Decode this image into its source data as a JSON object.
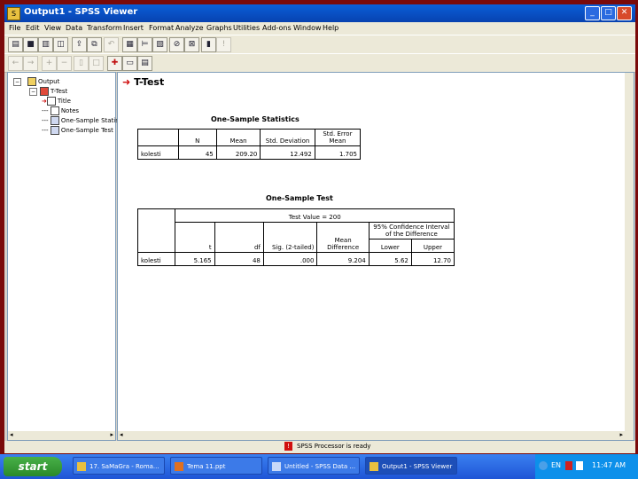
{
  "window": {
    "title": "Output1 - SPSS Viewer"
  },
  "menu": [
    "File",
    "Edit",
    "View",
    "Data",
    "Transform",
    "Insert",
    "Format",
    "Analyze",
    "Graphs",
    "Utilities",
    "Add-ons",
    "Window",
    "Help"
  ],
  "tree": {
    "items": [
      {
        "label": "Output"
      },
      {
        "label": "T-Test"
      },
      {
        "label": "Title"
      },
      {
        "label": "Notes"
      },
      {
        "label": "One-Sample Statis"
      },
      {
        "label": "One-Sample Test"
      }
    ]
  },
  "content": {
    "heading": "T-Test",
    "stats": {
      "title": "One-Sample Statistics",
      "headers": [
        "N",
        "Mean",
        "Std. Deviation",
        "Std. Error Mean"
      ],
      "row": {
        "label": "kolesti",
        "values": [
          "45",
          "209.20",
          "12.492",
          "1.705"
        ]
      }
    },
    "test": {
      "title": "One-Sample Test",
      "test_value": "Test Value = 200",
      "ci_header": "95% Confidence Interval of the Difference",
      "headers": [
        "t",
        "df",
        "Sig. (2-tailed)",
        "Mean Difference",
        "Lower",
        "Upper"
      ],
      "row": {
        "label": "kolesti",
        "values": [
          "5.165",
          "48",
          ".000",
          "9.204",
          "5.62",
          "12.70"
        ]
      }
    }
  },
  "status": {
    "text": "SPSS Processor is ready"
  },
  "taskbar": {
    "start": "start",
    "tasks": [
      {
        "label": "17. SaMaGra - Roma..."
      },
      {
        "label": "Tema 11.ppt"
      },
      {
        "label": "Untitled - SPSS Data ..."
      },
      {
        "label": "Output1 - SPSS Viewer"
      }
    ],
    "clock": "11:47 AM",
    "language": "EN"
  }
}
